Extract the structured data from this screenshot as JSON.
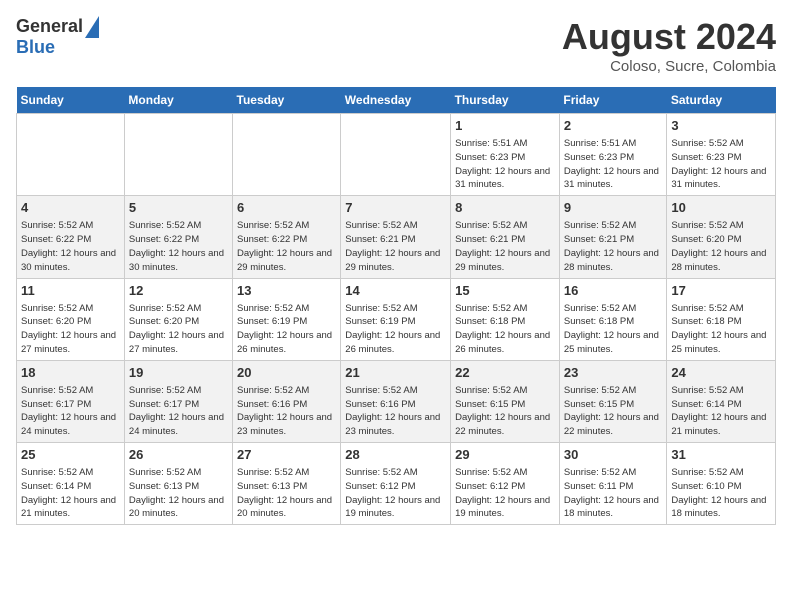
{
  "header": {
    "logo_general": "General",
    "logo_blue": "Blue",
    "month_title": "August 2024",
    "subtitle": "Coloso, Sucre, Colombia"
  },
  "days_of_week": [
    "Sunday",
    "Monday",
    "Tuesday",
    "Wednesday",
    "Thursday",
    "Friday",
    "Saturday"
  ],
  "weeks": [
    [
      {
        "day": "",
        "info": ""
      },
      {
        "day": "",
        "info": ""
      },
      {
        "day": "",
        "info": ""
      },
      {
        "day": "",
        "info": ""
      },
      {
        "day": "1",
        "info": "Sunrise: 5:51 AM\nSunset: 6:23 PM\nDaylight: 12 hours and 31 minutes."
      },
      {
        "day": "2",
        "info": "Sunrise: 5:51 AM\nSunset: 6:23 PM\nDaylight: 12 hours and 31 minutes."
      },
      {
        "day": "3",
        "info": "Sunrise: 5:52 AM\nSunset: 6:23 PM\nDaylight: 12 hours and 31 minutes."
      }
    ],
    [
      {
        "day": "4",
        "info": "Sunrise: 5:52 AM\nSunset: 6:22 PM\nDaylight: 12 hours and 30 minutes."
      },
      {
        "day": "5",
        "info": "Sunrise: 5:52 AM\nSunset: 6:22 PM\nDaylight: 12 hours and 30 minutes."
      },
      {
        "day": "6",
        "info": "Sunrise: 5:52 AM\nSunset: 6:22 PM\nDaylight: 12 hours and 29 minutes."
      },
      {
        "day": "7",
        "info": "Sunrise: 5:52 AM\nSunset: 6:21 PM\nDaylight: 12 hours and 29 minutes."
      },
      {
        "day": "8",
        "info": "Sunrise: 5:52 AM\nSunset: 6:21 PM\nDaylight: 12 hours and 29 minutes."
      },
      {
        "day": "9",
        "info": "Sunrise: 5:52 AM\nSunset: 6:21 PM\nDaylight: 12 hours and 28 minutes."
      },
      {
        "day": "10",
        "info": "Sunrise: 5:52 AM\nSunset: 6:20 PM\nDaylight: 12 hours and 28 minutes."
      }
    ],
    [
      {
        "day": "11",
        "info": "Sunrise: 5:52 AM\nSunset: 6:20 PM\nDaylight: 12 hours and 27 minutes."
      },
      {
        "day": "12",
        "info": "Sunrise: 5:52 AM\nSunset: 6:20 PM\nDaylight: 12 hours and 27 minutes."
      },
      {
        "day": "13",
        "info": "Sunrise: 5:52 AM\nSunset: 6:19 PM\nDaylight: 12 hours and 26 minutes."
      },
      {
        "day": "14",
        "info": "Sunrise: 5:52 AM\nSunset: 6:19 PM\nDaylight: 12 hours and 26 minutes."
      },
      {
        "day": "15",
        "info": "Sunrise: 5:52 AM\nSunset: 6:18 PM\nDaylight: 12 hours and 26 minutes."
      },
      {
        "day": "16",
        "info": "Sunrise: 5:52 AM\nSunset: 6:18 PM\nDaylight: 12 hours and 25 minutes."
      },
      {
        "day": "17",
        "info": "Sunrise: 5:52 AM\nSunset: 6:18 PM\nDaylight: 12 hours and 25 minutes."
      }
    ],
    [
      {
        "day": "18",
        "info": "Sunrise: 5:52 AM\nSunset: 6:17 PM\nDaylight: 12 hours and 24 minutes."
      },
      {
        "day": "19",
        "info": "Sunrise: 5:52 AM\nSunset: 6:17 PM\nDaylight: 12 hours and 24 minutes."
      },
      {
        "day": "20",
        "info": "Sunrise: 5:52 AM\nSunset: 6:16 PM\nDaylight: 12 hours and 23 minutes."
      },
      {
        "day": "21",
        "info": "Sunrise: 5:52 AM\nSunset: 6:16 PM\nDaylight: 12 hours and 23 minutes."
      },
      {
        "day": "22",
        "info": "Sunrise: 5:52 AM\nSunset: 6:15 PM\nDaylight: 12 hours and 22 minutes."
      },
      {
        "day": "23",
        "info": "Sunrise: 5:52 AM\nSunset: 6:15 PM\nDaylight: 12 hours and 22 minutes."
      },
      {
        "day": "24",
        "info": "Sunrise: 5:52 AM\nSunset: 6:14 PM\nDaylight: 12 hours and 21 minutes."
      }
    ],
    [
      {
        "day": "25",
        "info": "Sunrise: 5:52 AM\nSunset: 6:14 PM\nDaylight: 12 hours and 21 minutes."
      },
      {
        "day": "26",
        "info": "Sunrise: 5:52 AM\nSunset: 6:13 PM\nDaylight: 12 hours and 20 minutes."
      },
      {
        "day": "27",
        "info": "Sunrise: 5:52 AM\nSunset: 6:13 PM\nDaylight: 12 hours and 20 minutes."
      },
      {
        "day": "28",
        "info": "Sunrise: 5:52 AM\nSunset: 6:12 PM\nDaylight: 12 hours and 19 minutes."
      },
      {
        "day": "29",
        "info": "Sunrise: 5:52 AM\nSunset: 6:12 PM\nDaylight: 12 hours and 19 minutes."
      },
      {
        "day": "30",
        "info": "Sunrise: 5:52 AM\nSunset: 6:11 PM\nDaylight: 12 hours and 18 minutes."
      },
      {
        "day": "31",
        "info": "Sunrise: 5:52 AM\nSunset: 6:10 PM\nDaylight: 12 hours and 18 minutes."
      }
    ]
  ]
}
